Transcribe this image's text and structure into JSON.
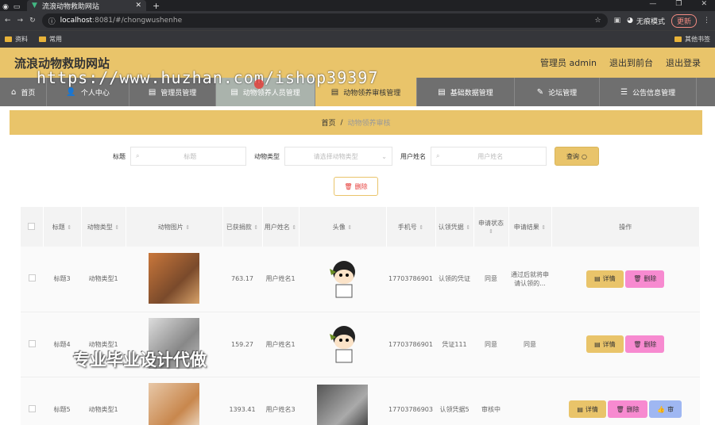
{
  "browser": {
    "tab_title": "流浪动物救助网站",
    "url_host": "localhost",
    "url_path": ":8081/#/chongwushenhe",
    "profile": "无痕模式",
    "update": "更新",
    "bookmarks": [
      "资料",
      "常用"
    ],
    "bookmarks_right": "其他书签"
  },
  "header": {
    "brand": "流浪动物救助网站",
    "user": "管理员 admin",
    "front": "退出到前台",
    "logout": "退出登录"
  },
  "nav": {
    "items": [
      "首页",
      "个人中心",
      "管理员管理",
      "动物领养人员管理",
      "动物领养审核管理",
      "基础数据管理",
      "论坛管理",
      "公告信息管理"
    ]
  },
  "watermark_text": "https://www.huzhan.com/ishop39397",
  "breadcrumb": {
    "home": "首页",
    "sep": "/",
    "current": "动物领养审核"
  },
  "search": {
    "title_label": "标题",
    "title_ph": "标题",
    "type_label": "动物类型",
    "type_ph": "请选择动物类型",
    "user_label": "用户姓名",
    "user_ph": "用户姓名",
    "query_btn": "查询"
  },
  "delete_btn": "删除",
  "table": {
    "headers": [
      "标题",
      "动物类型",
      "动物图片",
      "已获捐款",
      "用户姓名",
      "头像",
      "手机号",
      "认领凭据",
      "申请状态",
      "申请结果",
      "操作"
    ],
    "rows": [
      {
        "title": "标题3",
        "type": "动物类型1",
        "money": "763.17",
        "user": "用户姓名1",
        "phone": "17703786901",
        "proof": "认领的凭证",
        "status": "同意",
        "result": "通过后就将申请认领的..."
      },
      {
        "title": "标题4",
        "type": "动物类型1",
        "money": "159.27",
        "user": "用户姓名1",
        "phone": "17703786901",
        "proof": "凭证111",
        "status": "同意",
        "result": "同意"
      },
      {
        "title": "标题5",
        "type": "动物类型1",
        "money": "1393.41",
        "user": "用户姓名3",
        "phone": "17703786903",
        "proof": "认领凭据5",
        "status": "审核中",
        "result": ""
      }
    ],
    "detail_btn": "详情",
    "del_btn": "删除",
    "review_btn": "审"
  },
  "bottom_watermark": "专业毕业设计代做"
}
